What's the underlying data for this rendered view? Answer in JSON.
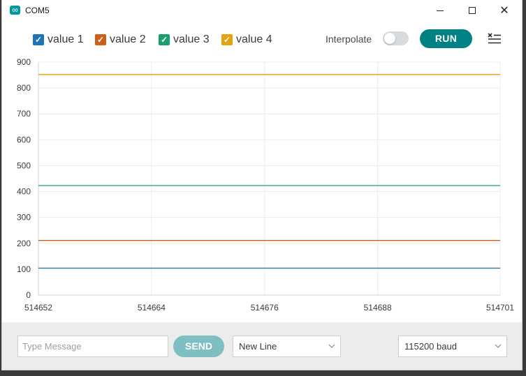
{
  "window": {
    "title": "COM5"
  },
  "legend": [
    {
      "label": "value 1",
      "color": "#1f73b7",
      "checked": true
    },
    {
      "label": "value 2",
      "color": "#c9611a",
      "checked": true
    },
    {
      "label": "value 3",
      "color": "#1aa06e",
      "checked": true
    },
    {
      "label": "value 4",
      "color": "#e8a10f",
      "checked": true
    }
  ],
  "toolbar": {
    "interpolate_label": "Interpolate",
    "interpolate_on": false,
    "run_label": "RUN"
  },
  "chart_data": {
    "type": "line",
    "x": [
      514652,
      514701
    ],
    "xticks": [
      "514652",
      "514664",
      "514676",
      "514688",
      "514701"
    ],
    "ylim": [
      0,
      900
    ],
    "yticks": [
      "0",
      "100",
      "200",
      "300",
      "400",
      "500",
      "600",
      "700",
      "800",
      "900"
    ],
    "grid": true,
    "series": [
      {
        "name": "value 1",
        "color": "#1f73b7",
        "values": [
          104,
          104
        ]
      },
      {
        "name": "value 2",
        "color": "#c9611a",
        "values": [
          211,
          211
        ]
      },
      {
        "name": "value 3",
        "color": "#1aa06e",
        "values": [
          423,
          423
        ]
      },
      {
        "name": "value 4",
        "color": "#e8a10f",
        "values": [
          852,
          852
        ]
      }
    ]
  },
  "footer": {
    "message_placeholder": "Type Message",
    "send_label": "SEND",
    "line_ending": "New Line",
    "baud": "115200 baud"
  },
  "colors": {
    "accent": "#008184",
    "send_disabled": "#7fbfc1"
  },
  "icons": {
    "app": "arduino-infinity-icon",
    "menu": "clear-list-icon"
  }
}
